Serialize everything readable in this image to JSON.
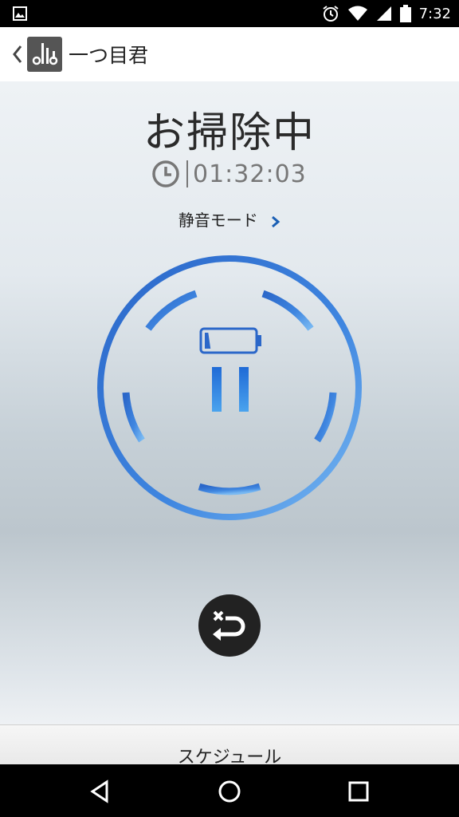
{
  "status_bar": {
    "time": "7:32"
  },
  "header": {
    "title": "一つ目君"
  },
  "main": {
    "status_title": "お掃除中",
    "elapsed_time": "01:32:03",
    "quiet_mode_label": "静音モード",
    "battery_level": 0.12
  },
  "bottom_tab": {
    "label": "スケジュール"
  },
  "colors": {
    "accent": "#2f6fd6",
    "ring_light": "#6aaef0",
    "button_dark": "#222222"
  },
  "icons": [
    "image-icon",
    "alarm-icon",
    "wifi-icon",
    "signal-icon",
    "battery-icon",
    "back-icon",
    "app-logo-icon",
    "clock-icon",
    "chevron-right-icon",
    "battery-level-icon",
    "pause-icon",
    "return-home-icon",
    "nav-back-icon",
    "nav-home-icon",
    "nav-recents-icon"
  ]
}
